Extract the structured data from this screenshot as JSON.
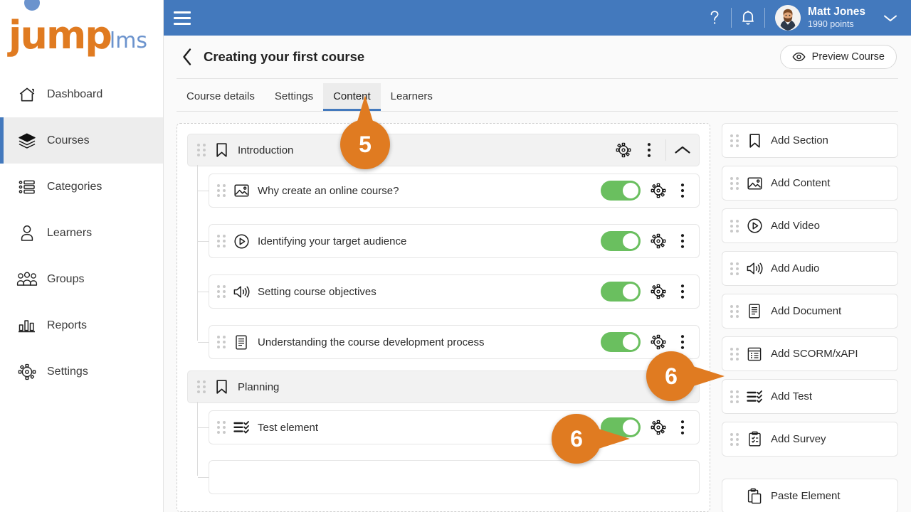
{
  "brand": {
    "logo_primary": "jump",
    "logo_secondary": "lms",
    "color_orange": "#e07b21",
    "color_blue": "#4379bd",
    "color_green": "#6abf5f"
  },
  "sidebar": {
    "items": [
      {
        "label": "Dashboard",
        "icon": "home-icon",
        "active": false
      },
      {
        "label": "Courses",
        "icon": "books-icon",
        "active": true
      },
      {
        "label": "Categories",
        "icon": "list-icon",
        "active": false
      },
      {
        "label": "Learners",
        "icon": "user-icon",
        "active": false
      },
      {
        "label": "Groups",
        "icon": "group-icon",
        "active": false
      },
      {
        "label": "Reports",
        "icon": "bar-chart-icon",
        "active": false
      },
      {
        "label": "Settings",
        "icon": "gear-icon",
        "active": false
      }
    ]
  },
  "topbar": {
    "menu_icon": "hamburger-icon",
    "help_icon": "question-mark-icon",
    "notifications_icon": "bell-icon",
    "help_glyph": "?",
    "user": {
      "name": "Matt Jones",
      "points": "1990 points",
      "avatar_icon": "avatar"
    },
    "caret_icon": "chevron-down-icon"
  },
  "page": {
    "back_icon": "chevron-left-icon",
    "title": "Creating your first course",
    "preview_button": {
      "label": "Preview Course",
      "icon": "eye-icon"
    }
  },
  "tabs": [
    {
      "label": "Course details",
      "active": false
    },
    {
      "label": "Settings",
      "active": false
    },
    {
      "label": "Content",
      "active": true
    },
    {
      "label": "Learners",
      "active": false
    }
  ],
  "content": {
    "sections": [
      {
        "title": "Introduction",
        "icon": "bookmark-icon",
        "collapse_icon": "chevron-up-icon",
        "settings_icon": "settings-gear-icon",
        "menu_icon": "kebab-menu-icon",
        "items": [
          {
            "title": "Why create an online course?",
            "icon": "image-icon",
            "enabled": true
          },
          {
            "title": "Identifying your target audience",
            "icon": "play-circle-icon",
            "enabled": true
          },
          {
            "title": "Setting course objectives",
            "icon": "speaker-icon",
            "enabled": true
          },
          {
            "title": "Understanding the course development process",
            "icon": "document-icon",
            "enabled": true
          }
        ]
      },
      {
        "title": "Planning",
        "icon": "bookmark-icon",
        "collapse_icon": "",
        "settings_icon": "settings-gear-icon",
        "menu_icon": "",
        "items": [
          {
            "title": "Test element",
            "icon": "test-icon",
            "enabled": true
          }
        ]
      }
    ]
  },
  "add_panel": {
    "buttons": [
      {
        "label": "Add Section",
        "icon": "bookmark-icon"
      },
      {
        "label": "Add Content",
        "icon": "image-icon"
      },
      {
        "label": "Add Video",
        "icon": "play-circle-icon"
      },
      {
        "label": "Add Audio",
        "icon": "speaker-icon"
      },
      {
        "label": "Add Document",
        "icon": "document-icon"
      },
      {
        "label": "Add SCORM/xAPI",
        "icon": "scorm-icon"
      },
      {
        "label": "Add Test",
        "icon": "test-icon"
      },
      {
        "label": "Add Survey",
        "icon": "survey-icon"
      }
    ],
    "paste_button": {
      "label": "Paste Element",
      "icon": "paste-icon"
    }
  },
  "callouts": [
    {
      "number": "5",
      "points_to": "content-tab",
      "direction": "up"
    },
    {
      "number": "6",
      "points_to": "add-test-button",
      "direction": "right"
    },
    {
      "number": "6",
      "points_to": "test-element-settings",
      "direction": "right"
    }
  ]
}
